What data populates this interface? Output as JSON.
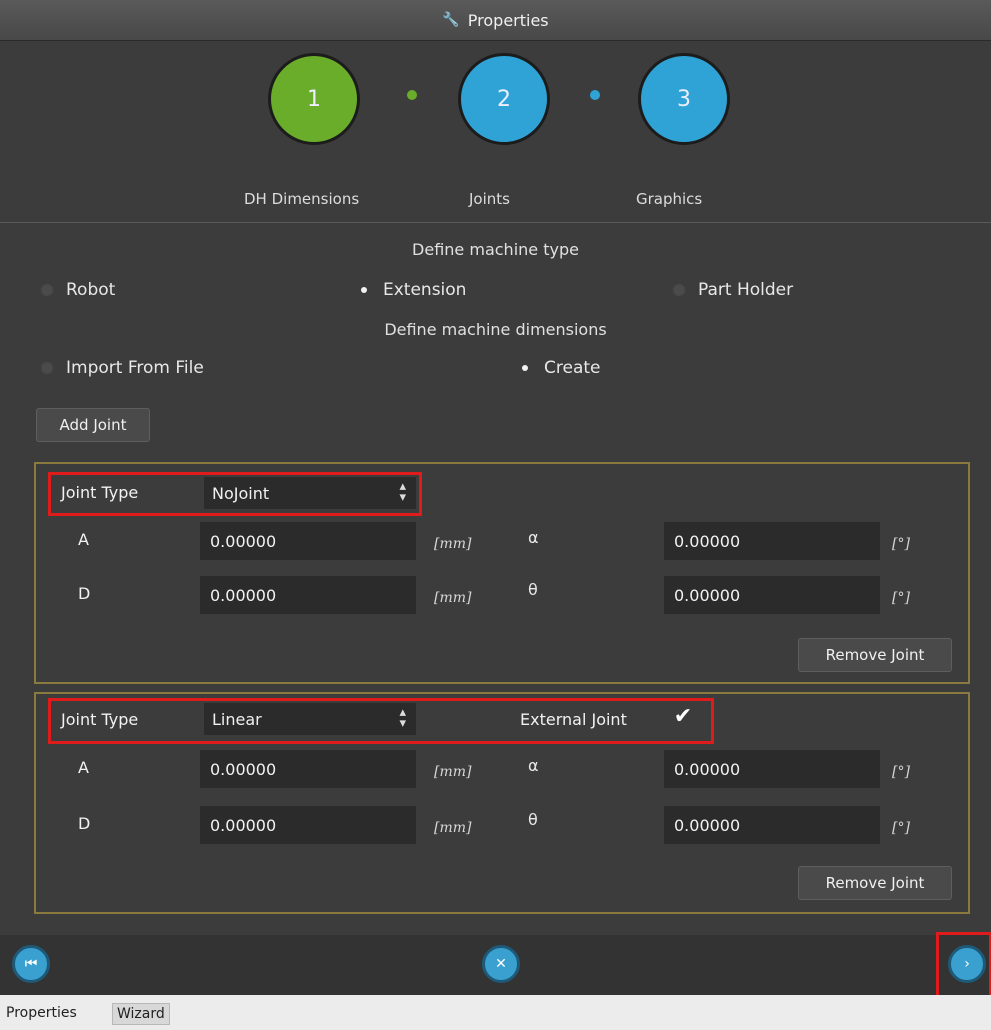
{
  "window": {
    "title": "Properties"
  },
  "wizard": {
    "steps": [
      {
        "number": "1",
        "label": "DH Dimensions",
        "color": "#6aad2a"
      },
      {
        "number": "2",
        "label": "Joints",
        "color": "#2fa3d6"
      },
      {
        "number": "3",
        "label": "Graphics",
        "color": "#2fa3d6"
      }
    ]
  },
  "machine_type": {
    "title": "Define machine type",
    "options": [
      "Robot",
      "Extension",
      "Part Holder"
    ],
    "selected": "Extension"
  },
  "machine_dimensions": {
    "title": "Define machine dimensions",
    "options": [
      "Import From File",
      "Create"
    ],
    "selected": "Create"
  },
  "add_joint_label": "Add Joint",
  "joints": [
    {
      "joint_type_label": "Joint Type",
      "joint_type_value": "NoJoint",
      "a_label": "A",
      "a_value": "0.00000",
      "a_unit": "[mm]",
      "alpha_label": "α",
      "alpha_value": "0.00000",
      "alpha_unit": "[°]",
      "d_label": "D",
      "d_value": "0.00000",
      "d_unit": "[mm]",
      "theta_label": "θ",
      "theta_value": "0.00000",
      "theta_unit": "[°]",
      "remove_label": "Remove Joint"
    },
    {
      "joint_type_label": "Joint Type",
      "joint_type_value": "Linear",
      "external_joint_label": "External Joint",
      "external_joint_checked": true,
      "a_label": "A",
      "a_value": "0.00000",
      "a_unit": "[mm]",
      "alpha_label": "α",
      "alpha_value": "0.00000",
      "alpha_unit": "[°]",
      "d_label": "D",
      "d_value": "0.00000",
      "d_unit": "[mm]",
      "theta_label": "θ",
      "theta_value": "0.00000",
      "theta_unit": "[°]",
      "remove_label": "Remove Joint"
    }
  ],
  "navigation": {
    "first_icon": "skip-back-icon",
    "cancel_icon": "close-icon",
    "next_icon": "chevron-right-icon"
  },
  "bottom_tabs": [
    "Properties",
    "Wizard"
  ],
  "active_tab": "Wizard"
}
